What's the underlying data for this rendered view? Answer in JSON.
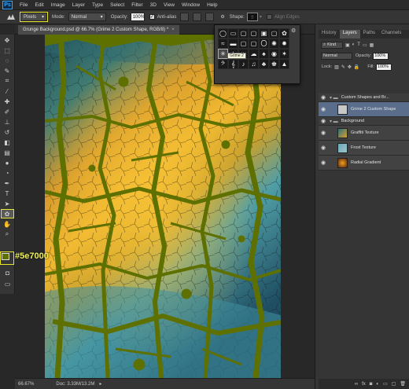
{
  "menu": {
    "logo": "Ps",
    "items": [
      "File",
      "Edit",
      "Image",
      "Layer",
      "Type",
      "Select",
      "Filter",
      "3D",
      "View",
      "Window",
      "Help"
    ]
  },
  "options": {
    "mode_select": "Pixels",
    "mode_label": "Mode:",
    "mode_value": "Normal",
    "opacity_label": "Opacity:",
    "opacity_value": "100%",
    "antialias_label": "Anti-alias",
    "shape_label": "Shape:",
    "align_edges_label": "Align Edges"
  },
  "document": {
    "tab_title": "Grunge Background.psd @ 66.7% (Grime 2 Custom Shape, RGB/8) *"
  },
  "shape_picker": {
    "tooltip": "Grime 2",
    "shapes": [
      "◯",
      "▭",
      "▢",
      "▢",
      "▣",
      "▢",
      "✿",
      "≈",
      "▬",
      "▢",
      "▢",
      "〇",
      "✺",
      "✹",
      "✳",
      "✦",
      "❧",
      "☁",
      "♠",
      "◉",
      "✶",
      "𝄢",
      "𝄞",
      "♪",
      "♫",
      "♣",
      "♚",
      "▲"
    ]
  },
  "foreground_color": {
    "hex": "#5e7000",
    "label": "#5e7000"
  },
  "status": {
    "zoom": "66.67%",
    "doc": "Doc: 3.33M/13.2M"
  },
  "panel": {
    "tabs": [
      "History",
      "Layers",
      "Paths",
      "Channels"
    ],
    "active_tab": "Layers",
    "kind": "Kind",
    "blend_mode": "Normal",
    "opacity_label": "Opacity:",
    "opacity_value": "100%",
    "lock_label": "Lock:",
    "fill_label": "Fill:",
    "fill_value": "100%",
    "layers": [
      {
        "name": "Custom Shapes and Br...",
        "type": "group",
        "selected": false,
        "indent": 0
      },
      {
        "name": "Grime 2 Custom Shape",
        "type": "layer",
        "selected": true,
        "indent": 1
      },
      {
        "name": "Background",
        "type": "group",
        "selected": false,
        "indent": 0
      },
      {
        "name": "Graffiti Texture",
        "type": "layer",
        "selected": false,
        "indent": 1
      },
      {
        "name": "Frost Texture",
        "type": "layer",
        "selected": false,
        "indent": 1
      },
      {
        "name": "Radial Gradient",
        "type": "layer",
        "selected": false,
        "indent": 1
      }
    ]
  },
  "colors": {
    "grime": "#5e7000",
    "highlight": "#e8e828"
  }
}
